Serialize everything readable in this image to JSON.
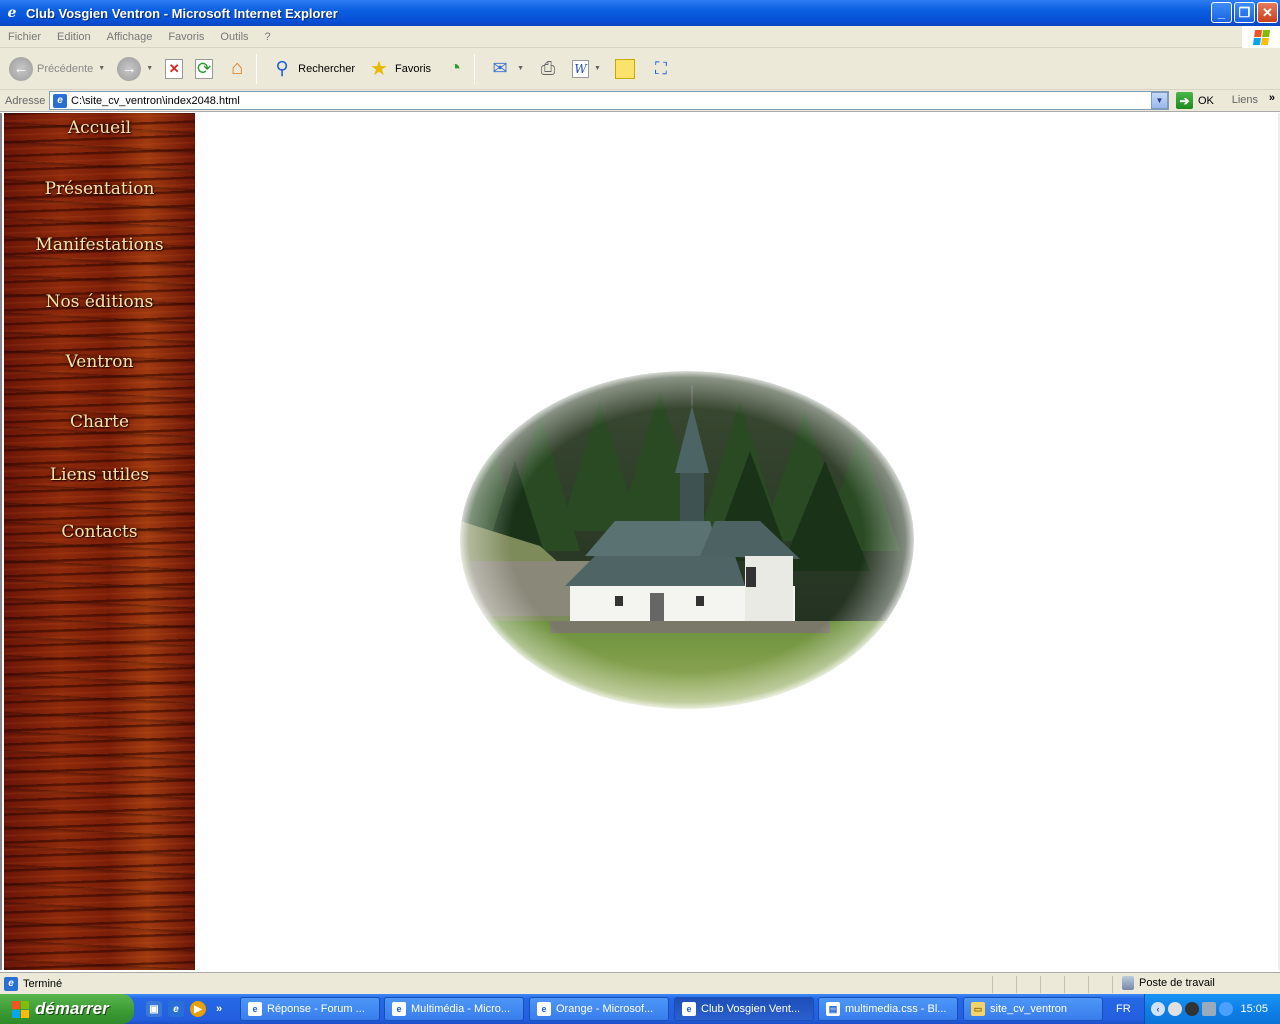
{
  "window": {
    "title": "Club Vosgien Ventron - Microsoft Internet Explorer"
  },
  "menu": {
    "items": [
      "Fichier",
      "Edition",
      "Affichage",
      "Favoris",
      "Outils",
      "?"
    ]
  },
  "toolbar": {
    "back_label": "Précédente",
    "search_label": "Rechercher",
    "favorites_label": "Favoris"
  },
  "address": {
    "label": "Adresse",
    "value": "C:\\site_cv_ventron\\index2048.html",
    "go_label": "OK",
    "links_label": "Liens"
  },
  "nav": {
    "items": [
      "Accueil",
      "Présentation",
      "Manifestations",
      "Nos éditions",
      "Ventron",
      "Charte",
      "Liens utiles",
      "Contacts"
    ]
  },
  "status": {
    "text": "Terminé",
    "zone": "Poste de travail"
  },
  "taskbar": {
    "start_label": "démarrer",
    "buttons": [
      "Réponse - Forum ...",
      "Multimédia - Micro...",
      "Orange - Microsof...",
      "Club Vosgien Vent...",
      "multimedia.css - Bl...",
      "site_cv_ventron"
    ],
    "lang": "FR",
    "clock": "15:05"
  },
  "colors": {
    "xp_blue": "#0a5ee0",
    "start_green": "#3b9a33",
    "wood": "#8e2a0c",
    "nav_text": "#f5e6a8"
  }
}
